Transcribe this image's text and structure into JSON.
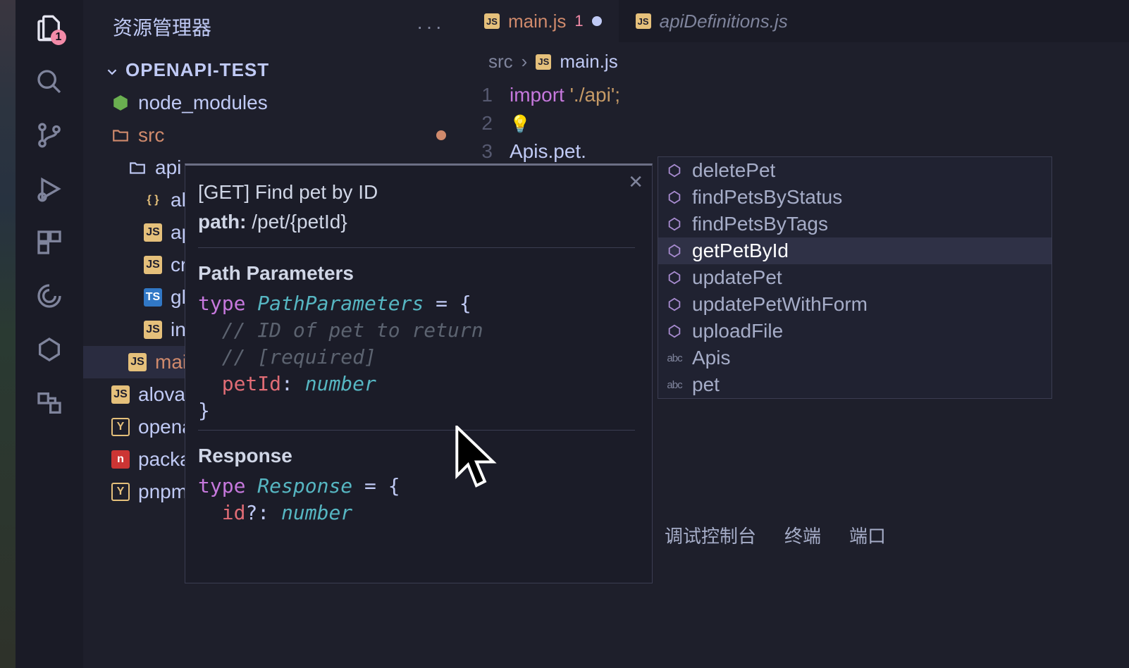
{
  "activity": {
    "files_badge": "1"
  },
  "sidebar": {
    "title": "资源管理器",
    "project": "OPENAPI-TEST",
    "tree": {
      "node_modules": "node_modules",
      "src": "src",
      "api": "api",
      "f0": "alo",
      "f1": "api",
      "f2": "cre",
      "f3": "glo",
      "f4": "ind",
      "main": "main",
      "alova": "alova",
      "openapi": "opena",
      "package": "packa",
      "pnpm": "pnpm"
    }
  },
  "tabs": {
    "t0": {
      "name": "main.js",
      "count": "1"
    },
    "t1": {
      "name": "apiDefinitions.js"
    }
  },
  "breadcrumb": {
    "p0": "src",
    "p1": "main.js"
  },
  "code": {
    "l1a": "import",
    "l1b": " '",
    "l1c": "./api",
    "l1d": "';",
    "l3": "Apis.pet."
  },
  "completions": {
    "c0": "deletePet",
    "c1": "findPetsByStatus",
    "c2": "findPetsByTags",
    "c3": "getPetById",
    "c4": "updatePet",
    "c5": "updatePetWithForm",
    "c6": "uploadFile",
    "c7": "Apis",
    "c8": "pet"
  },
  "hover": {
    "title": "[GET] Find pet by ID",
    "path_label": "path:",
    "path_value": "/pet/{petId}",
    "sec_params": "Path Parameters",
    "pp_type": "type",
    "pp_name": "PathParameters",
    "pp_eq": " = {",
    "pp_c1": "// ID of pet to return",
    "pp_c2": "// [required]",
    "pp_field": "petId",
    "pp_colon": ": ",
    "pp_ftype": "number",
    "pp_close": "}",
    "sec_resp": "Response",
    "r_type": "type",
    "r_name": "Response",
    "r_eq": " = {",
    "r_field": "id",
    "r_opt": "?",
    "r_colon": ": ",
    "r_ftype": "number"
  },
  "bottom": {
    "b0": "调试控制台",
    "b1": "终端",
    "b2": "端口"
  }
}
